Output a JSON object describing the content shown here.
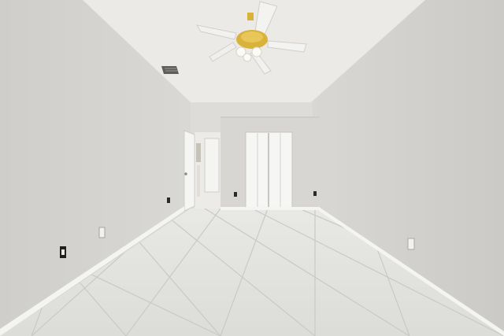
{
  "scene": {
    "subject": "empty-bedroom-interior",
    "colors": {
      "wall_left": "#d6d5d1",
      "wall_right": "#d3d2ce",
      "back_wall": "#dedcd8",
      "ceiling": "#ebeae7",
      "floor_tile": "#e3e3e0",
      "grout": "#c9c9c5",
      "baseboard": "#f4f4f2",
      "closet_door": "#f7f7f5",
      "fan_brass": "#d9b23a",
      "fan_blade": "#f3f3f1"
    },
    "icons": [
      "ceiling-fan-icon",
      "air-vent-icon",
      "electrical-outlet-icon",
      "light-switch-icon"
    ]
  }
}
